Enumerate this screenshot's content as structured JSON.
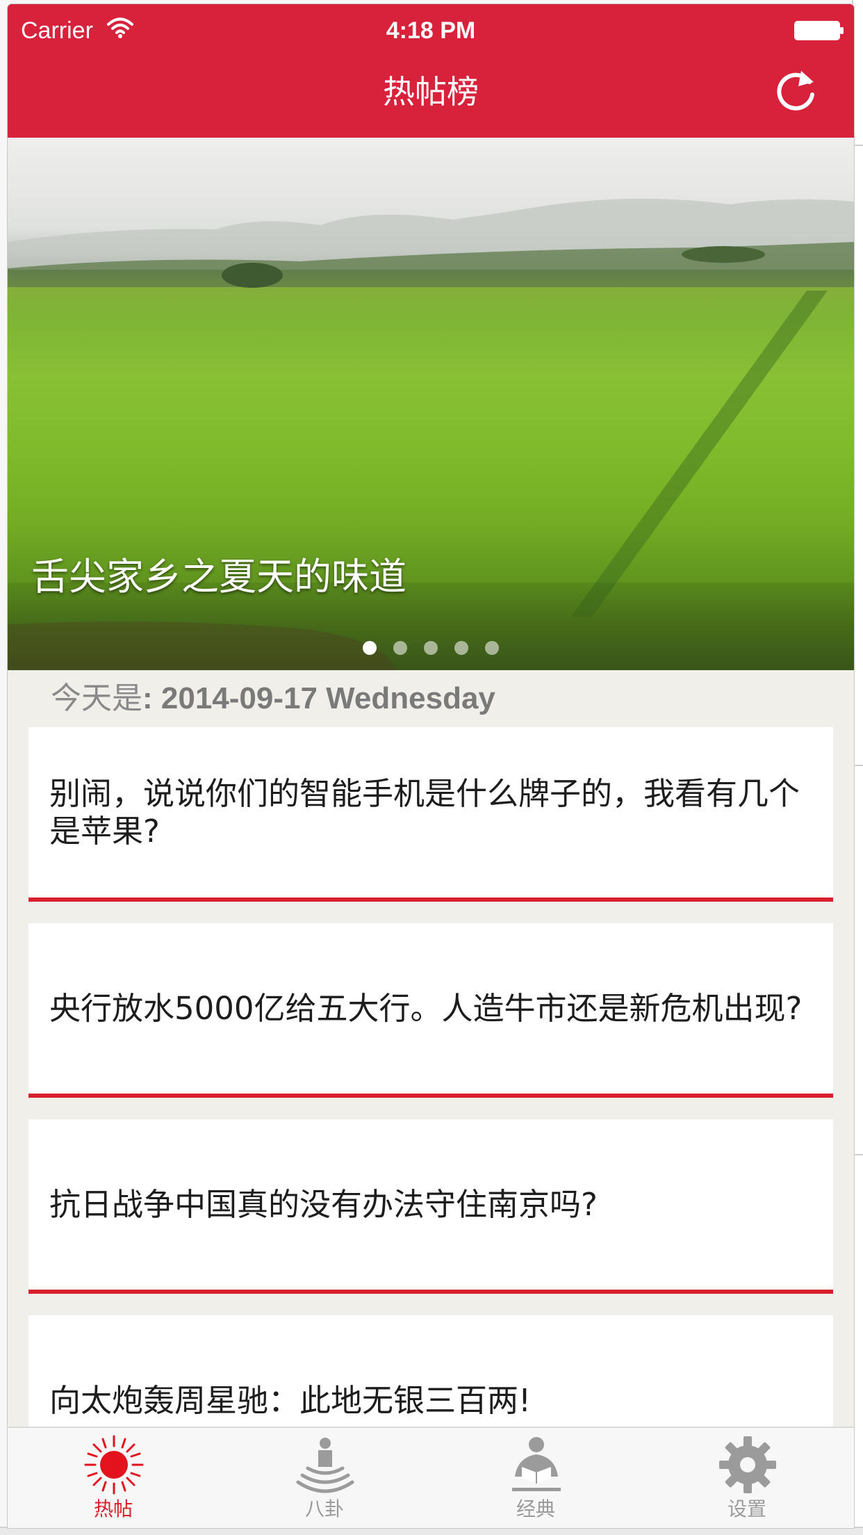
{
  "status_bar": {
    "carrier": "Carrier",
    "time": "4:18 PM"
  },
  "nav": {
    "title": "热帖榜",
    "refresh_icon": "refresh-icon"
  },
  "banner": {
    "caption": "舌尖家乡之夏天的味道",
    "page_count": 5,
    "current_page": 1
  },
  "date_line": {
    "prefix": "今天是",
    "value": ": 2014-09-17 Wednesday"
  },
  "posts": [
    {
      "title": "别闹，说说你们的智能手机是什么牌子的，我看有几个是苹果?"
    },
    {
      "title": "央行放水5000亿给五大行。人造牛市还是新危机出现?"
    },
    {
      "title": "抗日战争中国真的没有办法守住南京吗?"
    },
    {
      "title": "向太炮轰周星驰：此地无银三百两!"
    }
  ],
  "tabs": [
    {
      "label": "热帖",
      "icon": "sun-icon",
      "active": true
    },
    {
      "label": "八卦",
      "icon": "broadcast-person-icon",
      "active": false
    },
    {
      "label": "经典",
      "icon": "reader-icon",
      "active": false
    },
    {
      "label": "设置",
      "icon": "gear-icon",
      "active": false
    }
  ],
  "colors": {
    "brand_red": "#d8223b",
    "card_divider_red": "#d81f2c",
    "background": "#f1efe9",
    "tab_inactive": "#9b9b9b"
  }
}
